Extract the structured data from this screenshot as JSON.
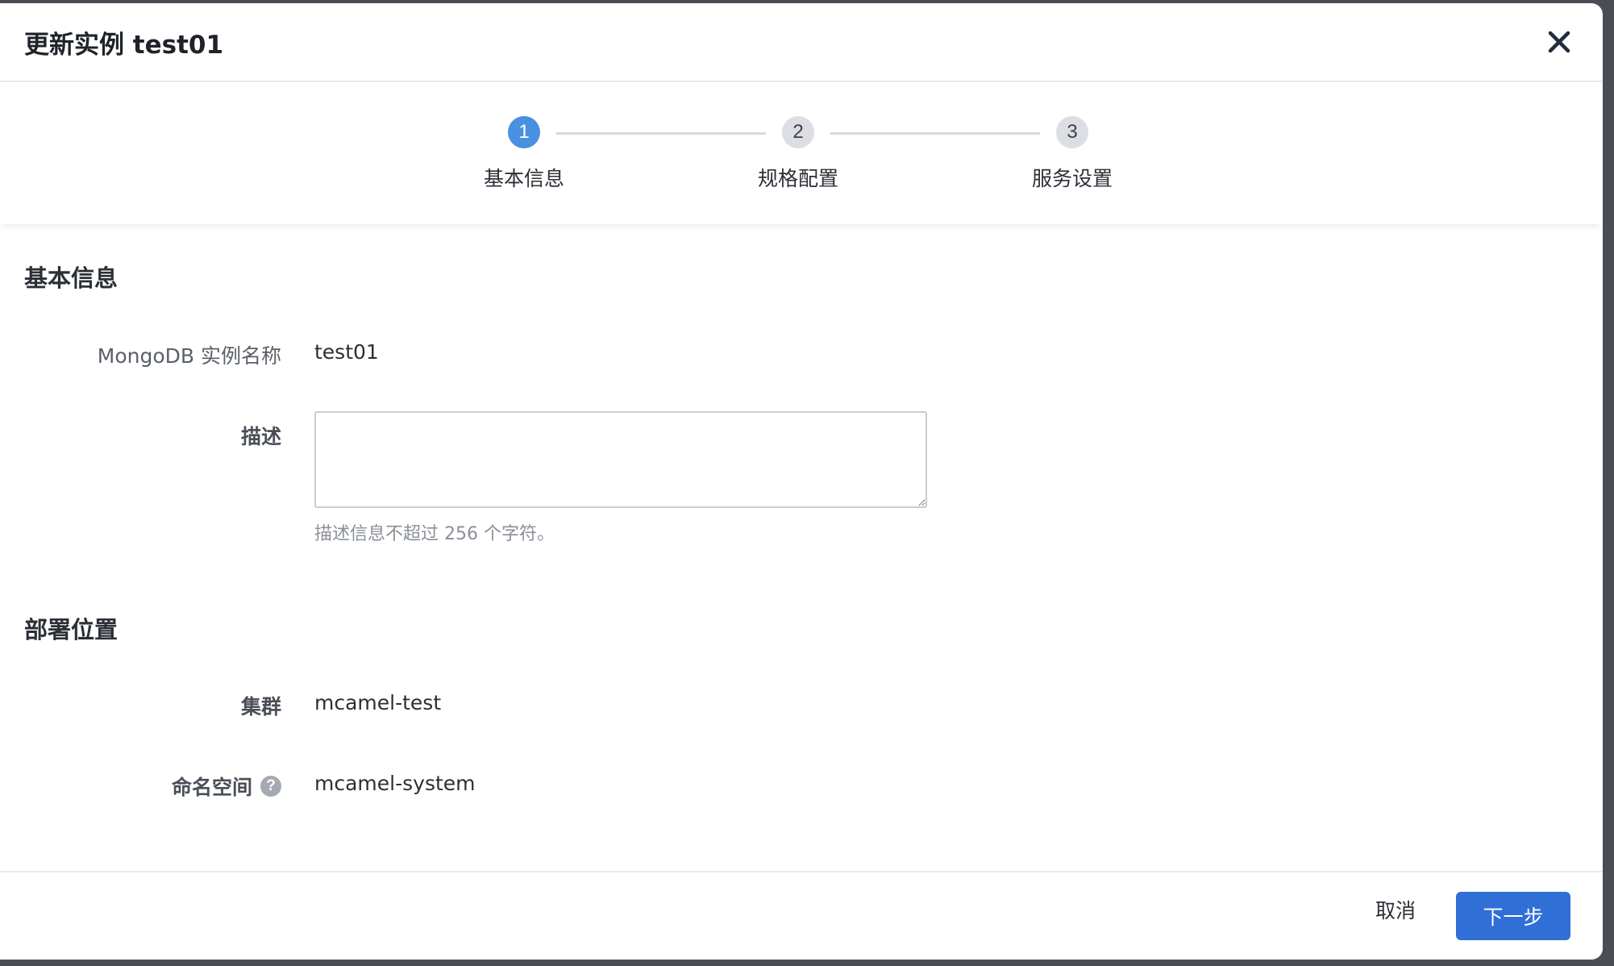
{
  "dialog": {
    "title": "更新实例 test01",
    "close_icon": "close-icon"
  },
  "steps": [
    {
      "number": "1",
      "label": "基本信息",
      "state": "active"
    },
    {
      "number": "2",
      "label": "规格配置",
      "state": "inactive"
    },
    {
      "number": "3",
      "label": "服务设置",
      "state": "inactive"
    }
  ],
  "basic_info": {
    "section_title": "基本信息",
    "name_label": "MongoDB 实例名称",
    "name_value": "test01",
    "desc_label": "描述",
    "desc_value": "",
    "desc_hint": "描述信息不超过 256 个字符。"
  },
  "deployment": {
    "section_title": "部署位置",
    "cluster_label": "集群",
    "cluster_value": "mcamel-test",
    "namespace_label": "命名空间",
    "namespace_help": "?",
    "namespace_value": "mcamel-system"
  },
  "footer": {
    "cancel_label": "取消",
    "next_label": "下一步"
  },
  "colors": {
    "primary": "#2f6fd6",
    "step_active": "#4a90e2",
    "step_inactive": "#dcdee3"
  }
}
